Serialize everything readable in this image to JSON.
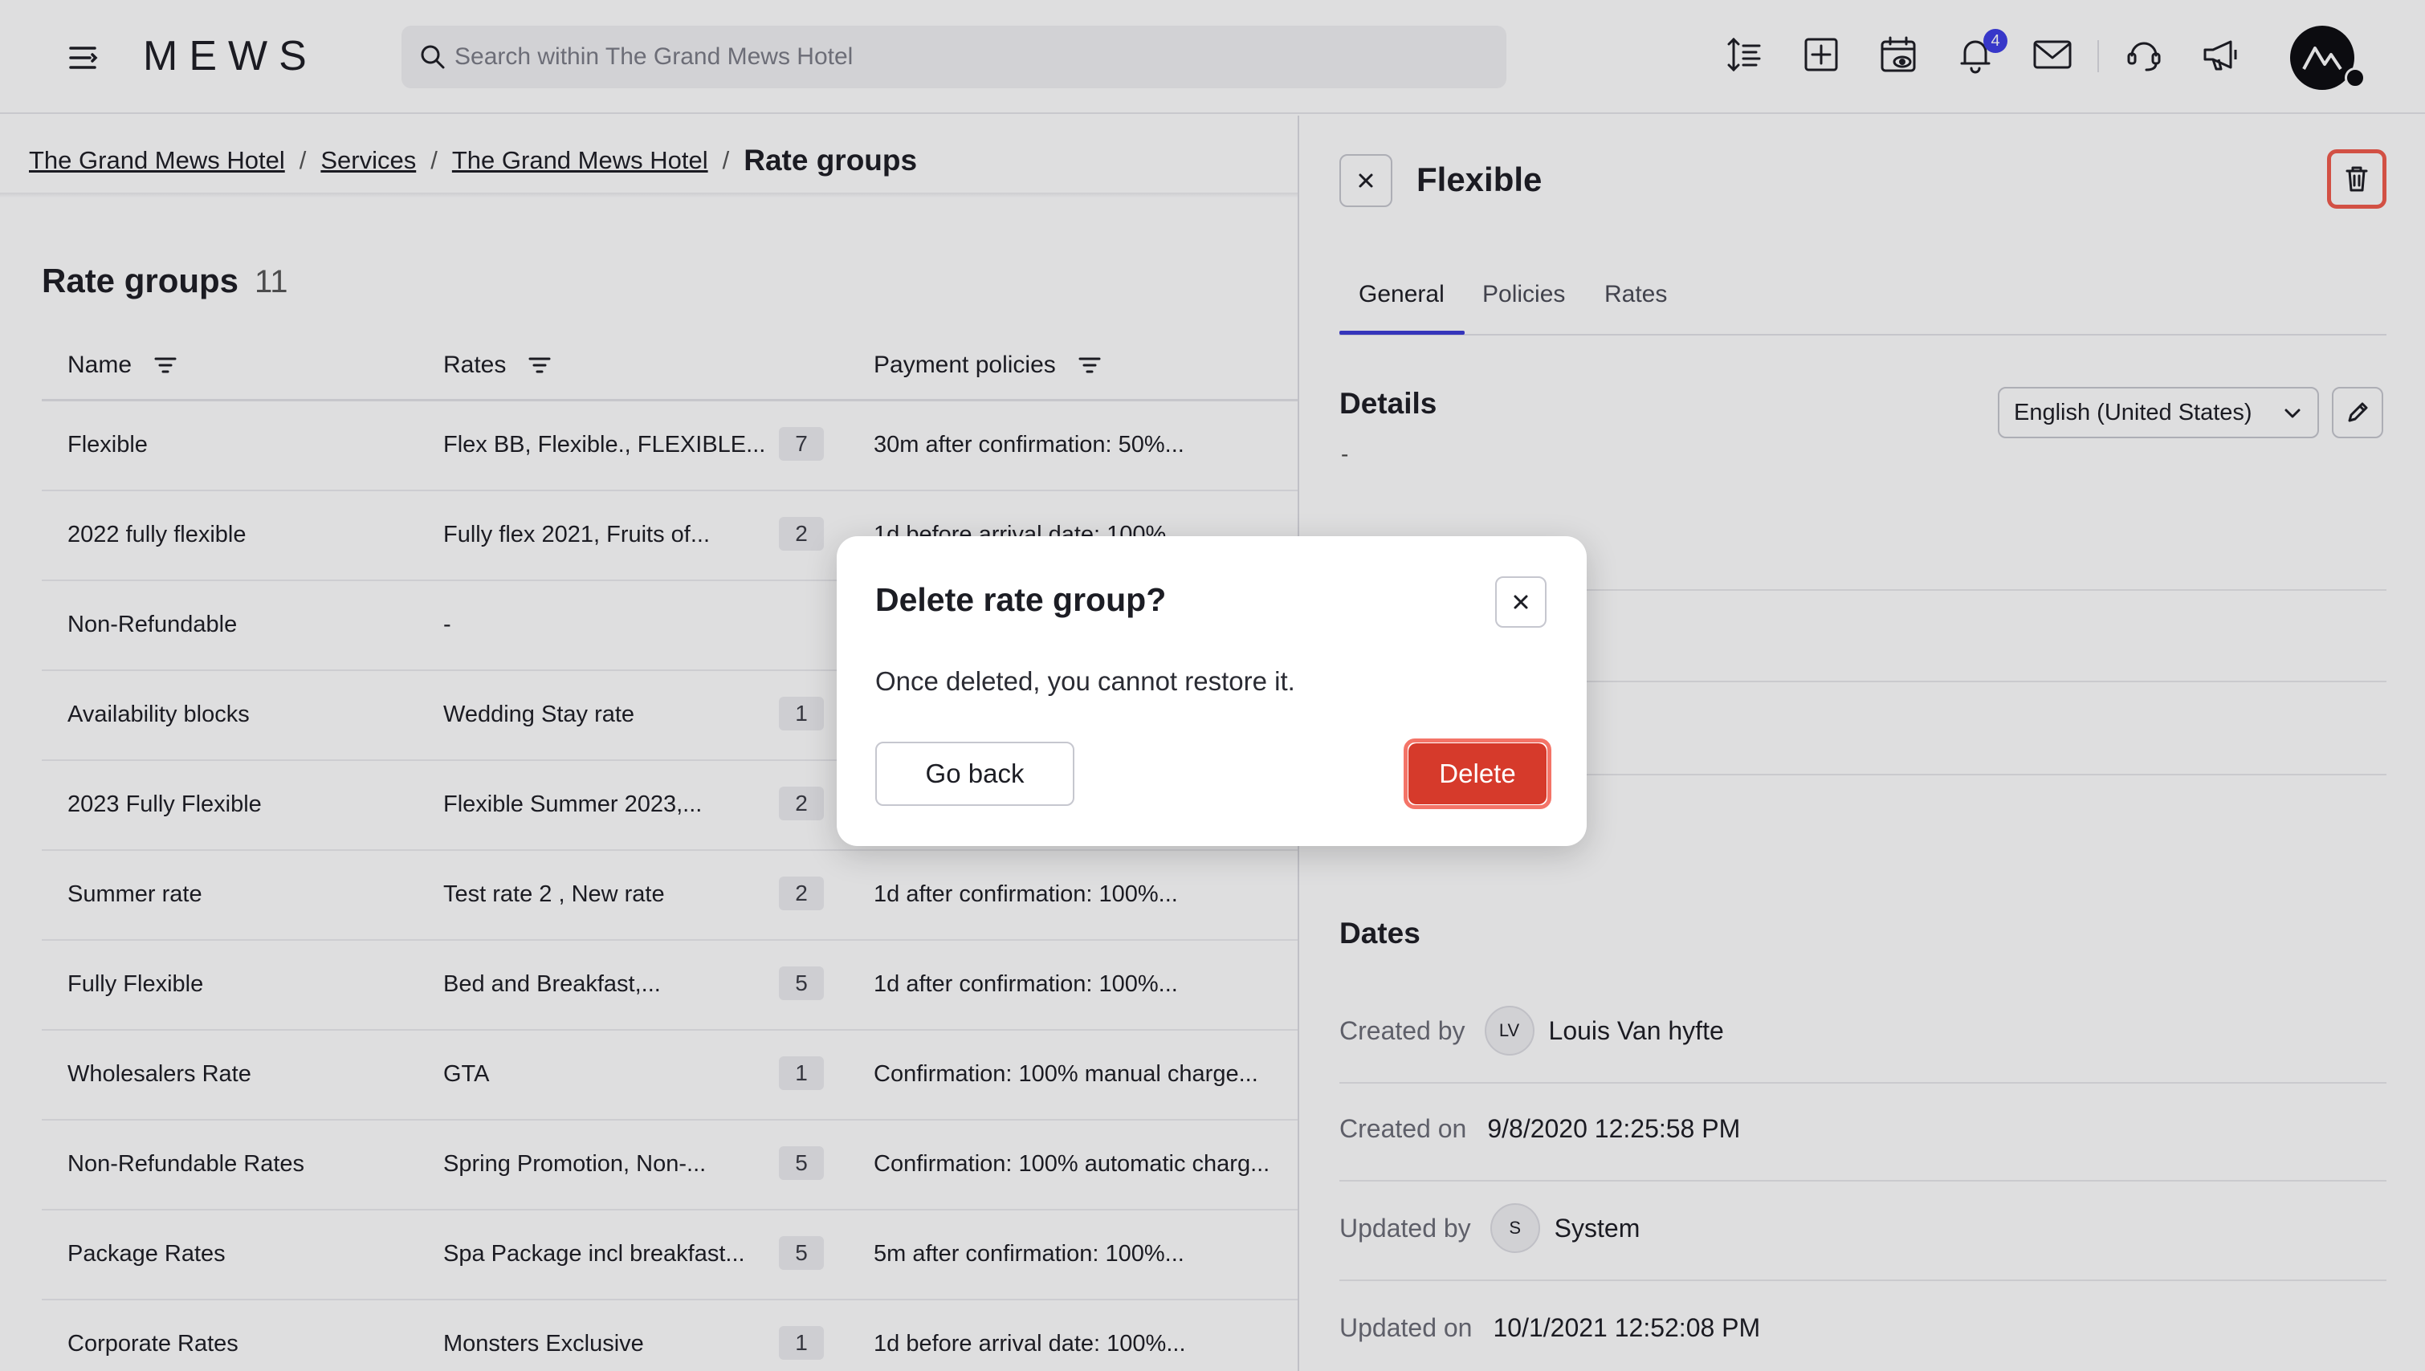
{
  "topbar": {
    "logo": "MEWS",
    "search_placeholder": "Search within The Grand Mews Hotel",
    "notification_count": "4",
    "icons": [
      "menu-icon",
      "sort-height-icon",
      "add-square-icon",
      "calendar-view-icon",
      "bell-icon",
      "mail-icon",
      "support-icon",
      "announcement-icon"
    ]
  },
  "breadcrumb": {
    "items": [
      "The Grand Mews Hotel",
      "Services",
      "The Grand Mews Hotel"
    ],
    "current": "Rate groups",
    "separator": "/"
  },
  "list": {
    "title": "Rate groups",
    "count": "11",
    "columns": [
      "Name",
      "Rates",
      "Payment policies"
    ],
    "rows": [
      {
        "name": "Flexible",
        "rates": "Flex BB, Flexible., FLEXIBLE...",
        "count": "7",
        "policy": "30m after confirmation: 50%..."
      },
      {
        "name": "2022 fully flexible",
        "rates": "Fully flex 2021, Fruits of...",
        "count": "2",
        "policy": "1d before arrival date: 100%..."
      },
      {
        "name": "Non-Refundable",
        "rates": "-",
        "count": "",
        "policy": ""
      },
      {
        "name": "Availability blocks",
        "rates": "Wedding Stay rate",
        "count": "1",
        "policy": ""
      },
      {
        "name": "2023 Fully Flexible",
        "rates": "Flexible Summer 2023,...",
        "count": "2",
        "policy": ""
      },
      {
        "name": "Summer rate",
        "rates": "Test rate 2 , New rate",
        "count": "2",
        "policy": "1d after confirmation: 100%..."
      },
      {
        "name": "Fully Flexible",
        "rates": "Bed and Breakfast,...",
        "count": "5",
        "policy": "1d after confirmation: 100%..."
      },
      {
        "name": "Wholesalers Rate",
        "rates": "GTA",
        "count": "1",
        "policy": "Confirmation: 100% manual charge..."
      },
      {
        "name": "Non-Refundable Rates",
        "rates": "Spring Promotion, Non-...",
        "count": "5",
        "policy": "Confirmation: 100% automatic charg..."
      },
      {
        "name": "Package Rates",
        "rates": "Spa Package incl breakfast...",
        "count": "5",
        "policy": "5m after confirmation: 100%..."
      },
      {
        "name": "Corporate Rates",
        "rates": "Monsters Exclusive",
        "count": "1",
        "policy": "1d before arrival date: 100%..."
      }
    ]
  },
  "detail": {
    "title": "Flexible",
    "tabs": [
      "General",
      "Policies",
      "Rates"
    ],
    "active_tab": "General",
    "details_heading": "Details",
    "details_value": "-",
    "language": "English (United States)",
    "dates_heading": "Dates",
    "created_by_label": "Created by",
    "created_by_initials": "LV",
    "created_by_name": "Louis Van hyfte",
    "created_on_label": "Created on",
    "created_on_value": "9/8/2020 12:25:58 PM",
    "updated_by_label": "Updated by",
    "updated_by_initials": "S",
    "updated_by_name": "System",
    "updated_on_label": "Updated on",
    "updated_on_value": "10/1/2021 12:52:08 PM"
  },
  "modal": {
    "title": "Delete rate group?",
    "body": "Once deleted, you cannot restore it.",
    "back_label": "Go back",
    "delete_label": "Delete"
  },
  "colors": {
    "accent": "#3b3bd6",
    "danger": "#d63a2b",
    "danger_ring": "#f15a4b",
    "badge": "#3d3de6"
  }
}
